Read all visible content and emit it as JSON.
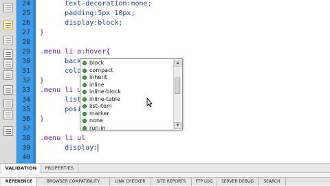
{
  "editor": {
    "line_numbers": [
      "24",
      "25",
      "26",
      "27",
      "28",
      "29",
      "30",
      "31",
      "32",
      "33",
      "34",
      "35",
      "36",
      "37",
      "38",
      "39",
      "40"
    ],
    "lines": [
      {
        "parts": [
          {
            "t": "      text-decoration:none;",
            "c": "prop"
          }
        ]
      },
      {
        "parts": [
          {
            "t": "      padding:5px 10px;",
            "c": "prop"
          }
        ]
      },
      {
        "parts": [
          {
            "t": "      display:block;",
            "c": "prop"
          }
        ]
      },
      {
        "parts": [
          {
            "t": "}",
            "c": "brace"
          }
        ]
      },
      {
        "parts": [
          {
            "t": "",
            "c": "prop"
          }
        ]
      },
      {
        "parts": [
          {
            "t": ".menu li a:hover{",
            "c": "selector"
          }
        ]
      },
      {
        "parts": [
          {
            "t": "      background:#333;",
            "c": "prop"
          }
        ]
      },
      {
        "parts": [
          {
            "t": "      color:#C",
            "c": "prop"
          }
        ]
      },
      {
        "parts": [
          {
            "t": "}",
            "c": "brace"
          }
        ]
      },
      {
        "parts": [
          {
            "t": ".menu li ul{",
            "c": "selector"
          }
        ]
      },
      {
        "parts": [
          {
            "t": "      list-sty",
            "c": "prop"
          }
        ]
      },
      {
        "parts": [
          {
            "t": "      position",
            "c": "prop"
          }
        ]
      },
      {
        "parts": [
          {
            "t": "}",
            "c": "brace"
          }
        ]
      },
      {
        "parts": [
          {
            "t": "",
            "c": "prop"
          }
        ]
      },
      {
        "parts": [
          {
            "t": ".menu li ul",
            "c": "selector"
          }
        ]
      },
      {
        "parts": [
          {
            "t": "      display:",
            "c": "prop"
          }
        ]
      },
      {
        "parts": [
          {
            "t": "",
            "c": "prop"
          }
        ]
      }
    ],
    "caret_line": 15
  },
  "autocomplete": {
    "items": [
      "block",
      "compact",
      "inherit",
      "inline",
      "inline-block",
      "inline-table",
      "list-item",
      "marker",
      "none",
      "run-in"
    ],
    "item_icon": "css-value-icon",
    "icon_color": "#3ea43a",
    "scroll_up_glyph": "▲",
    "scroll_down_glyph": "▼"
  },
  "panel_tabs": [
    {
      "label": "VALIDATION",
      "active": true
    },
    {
      "label": "PROPERTIES",
      "active": false
    }
  ],
  "bottom_tabs": [
    {
      "label": "REFERENCE",
      "active": true
    },
    {
      "label": "BROWSER COMPATIBILITY",
      "active": false
    },
    {
      "label": "LINK CHECKER",
      "active": false
    },
    {
      "label": "SITE REPORTS",
      "active": false
    },
    {
      "label": "FTP LOG",
      "active": false
    },
    {
      "label": "SERVER DEBUG",
      "active": false
    },
    {
      "label": "SEARCH",
      "active": false
    }
  ],
  "colors": {
    "gutter": "#3b9be6",
    "property_text": "#1f3fa8",
    "selector_text": "#7a1fa2"
  }
}
